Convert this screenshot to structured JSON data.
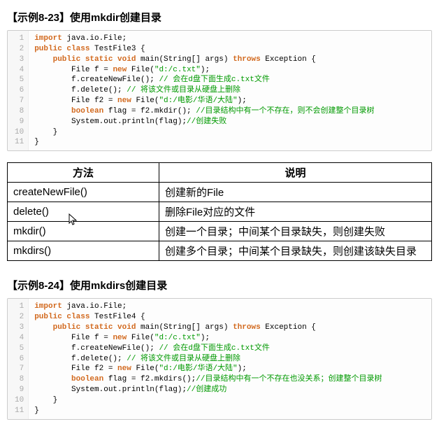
{
  "sections": {
    "example823": {
      "title": "【示例8-23】使用mkdir创建目录",
      "lineCount": 11,
      "code": {
        "l1": {
          "a": "import",
          "b": " java.io.File;"
        },
        "l2": {
          "a": "public class",
          "b": " TestFile3 {"
        },
        "l3": {
          "a": "public static void",
          "b": " main(String[] args) ",
          "c": "throws",
          "d": " Exception {"
        },
        "l4": {
          "a": "File f = ",
          "b": "new",
          "c": " File(",
          "d": "\"d:/c.txt\"",
          "e": ");"
        },
        "l5": {
          "a": "f.createNewFile(); ",
          "b": "// 会在d盘下面生成c.txt文件"
        },
        "l6": {
          "a": "f.delete(); ",
          "b": "// 将该文件或目录从硬盘上删除"
        },
        "l7": {
          "a": "File f2 = ",
          "b": "new",
          "c": " File(",
          "d": "\"d:/电影/华语/大陆\"",
          "e": ");"
        },
        "l8": {
          "a": "boolean",
          "b": " flag = f2.mkdir(); ",
          "c": "//目录结构中有一个不存在，则不会创建整个目录树"
        },
        "l9": {
          "a": "System.out.println(flag);",
          "b": "//创建失败"
        },
        "l10": {
          "a": "}"
        },
        "l11": {
          "a": "}"
        }
      }
    },
    "example824": {
      "title": "【示例8-24】使用mkdirs创建目录",
      "lineCount": 11,
      "code": {
        "l1": {
          "a": "import",
          "b": " java.io.File;"
        },
        "l2": {
          "a": "public class",
          "b": " TestFile4 {"
        },
        "l3": {
          "a": "public static void",
          "b": " main(String[] args) ",
          "c": "throws",
          "d": " Exception {"
        },
        "l4": {
          "a": "File f = ",
          "b": "new",
          "c": " File(",
          "d": "\"d:/c.txt\"",
          "e": ");"
        },
        "l5": {
          "a": "f.createNewFile(); ",
          "b": "// 会在d盘下面生成c.txt文件"
        },
        "l6": {
          "a": "f.delete(); ",
          "b": "// 将该文件或目录从硬盘上删除"
        },
        "l7": {
          "a": "File f2 = ",
          "b": "new",
          "c": " File(",
          "d": "\"d:/电影/华语/大陆\"",
          "e": ");"
        },
        "l8": {
          "a": "boolean",
          "b": " flag = f2.mkdirs();",
          "c": "//目录结构中有一个不存在也没关系；创建整个目录树"
        },
        "l9": {
          "a": "System.out.println(flag);",
          "b": "//创建成功"
        },
        "l10": {
          "a": "}"
        },
        "l11": {
          "a": "}"
        }
      }
    }
  },
  "table": {
    "headers": {
      "method": "方法",
      "desc": "说明"
    },
    "rows": [
      {
        "method": "createNewFile()",
        "desc": "创建新的File"
      },
      {
        "method": "delete()",
        "desc": "删除File对应的文件"
      },
      {
        "method": "mkdir()",
        "desc": "创建一个目录；中间某个目录缺失，则创建失败"
      },
      {
        "method": "mkdirs()",
        "desc": "创建多个目录；中间某个目录缺失，则创建该缺失目录"
      }
    ]
  }
}
